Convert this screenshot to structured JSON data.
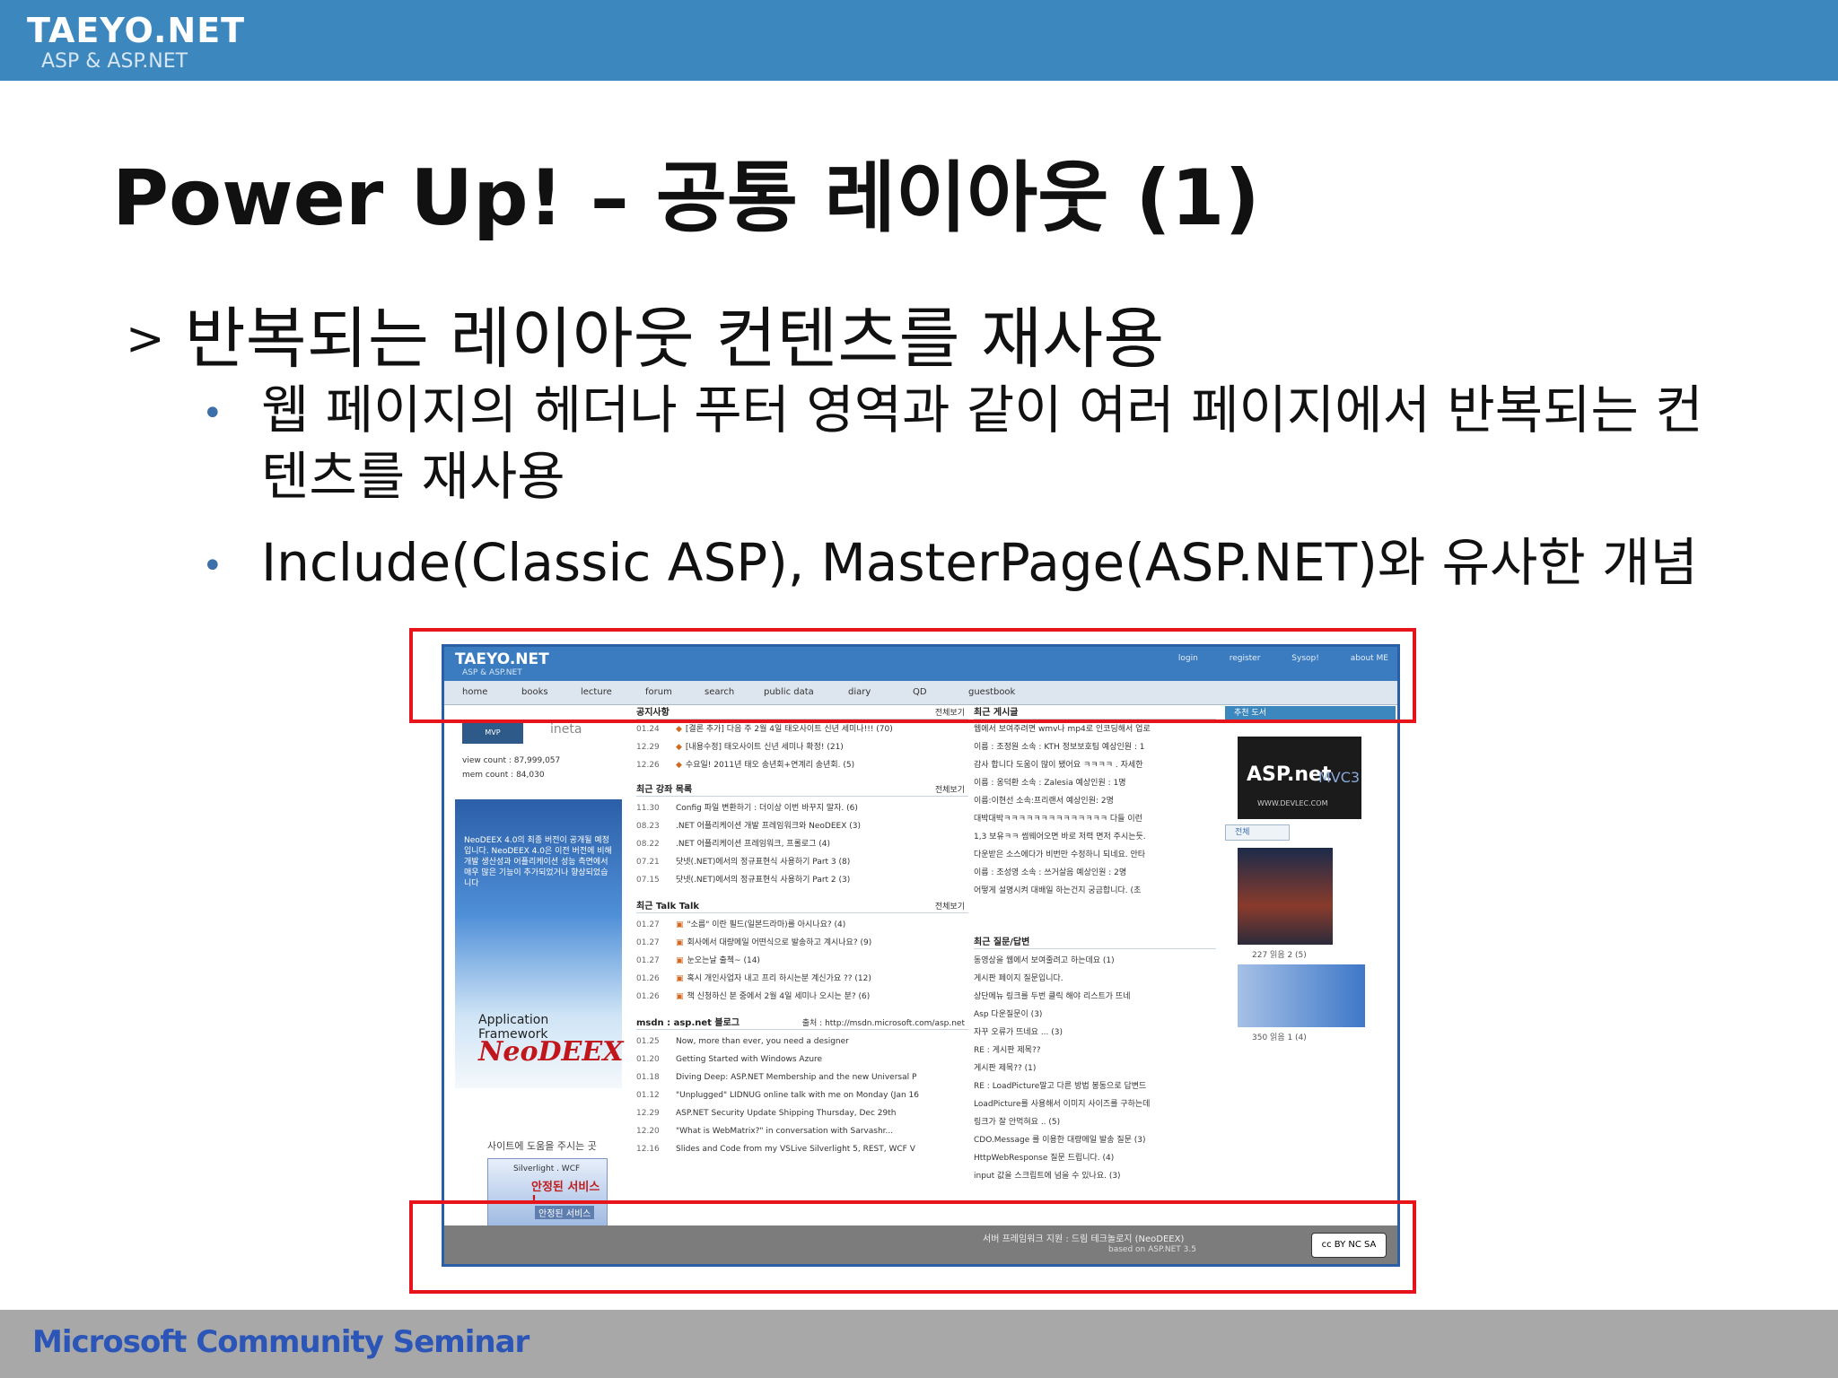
{
  "header": {
    "logo_title": "TAEYO.NET",
    "logo_subtitle": "ASP & ASP.NET"
  },
  "slide": {
    "title": "Power Up! – 공통 레이아웃 (1)",
    "bullet_l1_marker": ">",
    "bullet_l1": "반복되는 레이아웃 컨텐츠를 재사용",
    "bullet_l2": [
      "웹 페이지의 헤더나 푸터 영역과 같이 여러 페이지에서 반복되는 컨텐츠를 재사용",
      "Include(Classic ASP), MasterPage(ASP.NET)와 유사한 개념"
    ]
  },
  "screenshot": {
    "logo": "TAEYO.NET",
    "logo_sub": "ASP & ASP.NET",
    "top_links": [
      "login",
      "register",
      "Sysop!",
      "about ME"
    ],
    "nav": [
      "home",
      "books",
      "lecture",
      "forum",
      "search",
      "public data",
      "diary",
      "QD",
      "guestbook"
    ],
    "left": {
      "ineta": "ineta",
      "view_count": "view count : 87,999,057",
      "mem_count": "mem count : 84,030",
      "ad_text": "NeoDEEX 4.0의 최종 버전이 공개될 예정입니다. NeoDEEX 4.0은 이전 버전에 비해 개발 생산성과 어플리케이션 성능 측면에서 매우 많은 기능이 추가되었거나 향상되었습니다",
      "ad_app": "Application Framework",
      "ad_brand": "NeoDEEX",
      "help": "사이트에 도움을 주시는 곳",
      "svc_line1": "Silverlight . WCF",
      "svc_line2": "안정된 서비스 !",
      "svc_line3": "안정된 서비스"
    },
    "notices": {
      "header": "공지사항",
      "more": "전체보기",
      "rows": [
        {
          "date": "01.24",
          "text": "[결론 추가] 다음 주 2월 4일 태오사이트 신년 세미나!!! (70)"
        },
        {
          "date": "12.29",
          "text": "[내용수정] 태오사이트 신년 세미나 확정! (21)"
        },
        {
          "date": "12.26",
          "text": "수요일! 2011년 태오 송년회+연계리 송년회. (5)"
        }
      ]
    },
    "lectures": {
      "header": "최근 강좌 목록",
      "more": "전체보기",
      "rows": [
        {
          "date": "11.30",
          "text": "Config 파일 변환하기 : 더이상 이번 바꾸지 말자. (6)"
        },
        {
          "date": "08.23",
          "text": ".NET 어플리케이션 개발 프레임워크와 NeoDEEX (3)"
        },
        {
          "date": "08.22",
          "text": ".NET 어플리케이션 프레임워크, 프롤로그 (4)"
        },
        {
          "date": "07.21",
          "text": "닷넷(.NET)에서의 정규표현식 사용하기 Part 3 (8)"
        },
        {
          "date": "07.15",
          "text": "닷넷(.NET)에서의 정규표현식 사용하기 Part 2 (3)"
        }
      ]
    },
    "talk": {
      "header": "최근 Talk Talk",
      "more": "전체보기",
      "rows": [
        {
          "date": "01.27",
          "text": "\"소름\" 이란 필드(일본드라마)를 아시나요? (4)"
        },
        {
          "date": "01.27",
          "text": "회사에서 대량메일 어떤식으로 발송하고 계시나요? (9)"
        },
        {
          "date": "01.27",
          "text": "눈오는날 출첵~ (14)"
        },
        {
          "date": "01.26",
          "text": "혹시 개인사업자 내고 프리 하시는분 계신가요 ?? (12)"
        },
        {
          "date": "01.26",
          "text": "책 신청하신 분 중에서 2월 4일 세미나 오시는 분? (6)"
        }
      ]
    },
    "msdn": {
      "header": "msdn : asp.net 블로그",
      "source": "출처 : http://msdn.microsoft.com/asp.net",
      "rows": [
        {
          "date": "01.25",
          "text": "Now, more than ever, you need a designer"
        },
        {
          "date": "01.20",
          "text": "Getting Started with Windows Azure"
        },
        {
          "date": "01.18",
          "text": "Diving Deep: ASP.NET Membership and the new Universal P"
        },
        {
          "date": "01.12",
          "text": "\"Unplugged\" LIDNUG online talk with me on Monday (Jan 16"
        },
        {
          "date": "12.29",
          "text": "ASP.NET Security Update Shipping Thursday, Dec 29th"
        },
        {
          "date": "12.20",
          "text": "\"What is WebMatrix?\" in conversation with Sarvashr..."
        },
        {
          "date": "12.16",
          "text": "Slides and Code from my VSLive Silverlight 5, REST, WCF V"
        }
      ]
    },
    "recent_comments": {
      "header": "최근 게시글",
      "rows": [
        "웹에서 보여주려면 wmv나 mp4로 인코딩해서 업로",
        "이름 : 조정원 소속 : KTH 정보보호팀 예상인원 : 1",
        "감사 합니다 도움이 많이 됐어요 ㅋㅋㅋㅋ . 자세한",
        "이름 : 옹덕환 소속 : Zalesia 예상인원 : 1명",
        "이름:이현선 소속:프리랜서 예상인원: 2명",
        "대박대박ㅋㅋㅋㅋㅋㅋㅋㅋㅋㅋㅋㅋㅋㅋ 다들 이런",
        "1,3 보유ㅋㅋ 썸웨어오면 바로 저력 면저 주시는듯.",
        "다운받은 소스에다가 비번만 수정하니 되네요. 안타",
        "이름 : 조성영 소속 : 쓰거살음 예상인원 : 2명",
        "어떻게 설명시켜 대배일 하는건지 궁금합니다. (초"
      ]
    },
    "qna": {
      "header": "최근 질문/답변",
      "rows": [
        "동영상을 웹에서 보여줄려고 하는데요 (1)",
        "게시판 페이지 질문입니다.",
        "상단메뉴 링크를 두번 클릭 해야 리스트가 뜨네",
        "Asp 다운질문이 (3)",
        "자꾸 오류가 뜨네요 ... (3)",
        "RE : 게시판 제목??",
        "게시판 제목?? (1)",
        "RE : LoadPicture말고 다른 방법 봉동으로 답변드",
        "LoadPicture를 사용해서 이미지 사이즈를 구하는데",
        "링크가 잘 안먹혀요 .. (5)",
        "CDO.Message 를 이용한 대량메일 발송 질문 (3)",
        "HttpWebResponse 질문 드립니다. (4)",
        "input 값을 스크립트에 넘을 수 있나요. (3)"
      ]
    },
    "right": {
      "header1": "추천 도서",
      "asp_logo": "ASP.net",
      "mvc": "MVC3",
      "url": "WWW.DEVLEC.COM",
      "header2": "전체",
      "cap1": "227 읽음    2 (5)",
      "cap2": "350 읽음    1 (4)"
    },
    "footer": {
      "line1": "서버 프레임워크 지원 : 드림 테크놀로지 (NeoDEEX)",
      "line2": "based on ASP.NET 3.5",
      "cc": "cc BY NC SA"
    }
  },
  "bottom": {
    "brand": "Microsoft Community Seminar"
  },
  "colors": {
    "topbar": "#3d87bf",
    "highlight": "#e8141c",
    "bottombar": "#a8a8a8",
    "brand": "#2b56b7"
  }
}
